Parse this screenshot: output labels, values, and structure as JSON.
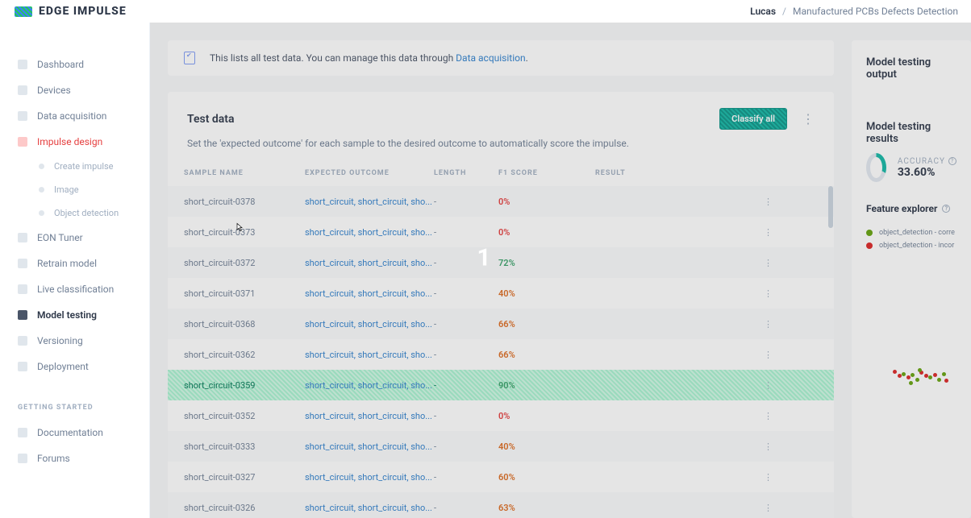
{
  "brand": "EDGE IMPULSE",
  "breadcrumb": {
    "user": "Lucas",
    "project": "Manufactured PCBs Defects Detection"
  },
  "sidebar": {
    "items": [
      {
        "label": "Dashboard"
      },
      {
        "label": "Devices"
      },
      {
        "label": "Data acquisition"
      },
      {
        "label": "Impulse design",
        "accent": true
      },
      {
        "label": "EON Tuner"
      },
      {
        "label": "Retrain model"
      },
      {
        "label": "Live classification"
      },
      {
        "label": "Model testing",
        "active": true
      },
      {
        "label": "Versioning"
      },
      {
        "label": "Deployment"
      }
    ],
    "subitems": [
      {
        "label": "Create impulse"
      },
      {
        "label": "Image"
      },
      {
        "label": "Object detection"
      }
    ],
    "section": "GETTING STARTED",
    "getting": [
      {
        "label": "Documentation"
      },
      {
        "label": "Forums"
      }
    ]
  },
  "banner": {
    "pre": "This lists all test data. You can manage this data through ",
    "link": "Data acquisition",
    "post": "."
  },
  "testdata": {
    "title": "Test data",
    "classify": "Classify all",
    "desc": "Set the 'expected outcome' for each sample to the desired outcome to automatically score the impulse.",
    "columns": {
      "c1": "SAMPLE NAME",
      "c2": "EXPECTED OUTCOME",
      "c3": "LENGTH",
      "c4": "F1 SCORE",
      "c5": "RESULT"
    },
    "rows": [
      {
        "name": "short_circuit-0378",
        "outcome": "short_circuit, short_circuit, sho...",
        "len": "-",
        "f1": "0%",
        "cls": "f1-red"
      },
      {
        "name": "short_circuit-0373",
        "outcome": "short_circuit, short_circuit, sho...",
        "len": "-",
        "f1": "0%",
        "cls": "f1-red"
      },
      {
        "name": "short_circuit-0372",
        "outcome": "short_circuit, short_circuit, sho...",
        "len": "-",
        "f1": "72%",
        "cls": "f1-green"
      },
      {
        "name": "short_circuit-0371",
        "outcome": "short_circuit, short_circuit, sho...",
        "len": "-",
        "f1": "40%",
        "cls": "f1-orange"
      },
      {
        "name": "short_circuit-0368",
        "outcome": "short_circuit, short_circuit, sho...",
        "len": "-",
        "f1": "66%",
        "cls": "f1-orange"
      },
      {
        "name": "short_circuit-0362",
        "outcome": "short_circuit, short_circuit, sho...",
        "len": "-",
        "f1": "66%",
        "cls": "f1-orange"
      },
      {
        "name": "short_circuit-0359",
        "outcome": "short_circuit, short_circuit, sho...",
        "len": "-",
        "f1": "90%",
        "cls": "f1-green",
        "selected": true
      },
      {
        "name": "short_circuit-0352",
        "outcome": "short_circuit, short_circuit, sho...",
        "len": "-",
        "f1": "0%",
        "cls": "f1-red"
      },
      {
        "name": "short_circuit-0333",
        "outcome": "short_circuit, short_circuit, sho...",
        "len": "-",
        "f1": "40%",
        "cls": "f1-orange"
      },
      {
        "name": "short_circuit-0327",
        "outcome": "short_circuit, short_circuit, sho...",
        "len": "-",
        "f1": "60%",
        "cls": "f1-orange"
      },
      {
        "name": "short_circuit-0326",
        "outcome": "short_circuit, short_circuit, sho...",
        "len": "-",
        "f1": "63%",
        "cls": "f1-orange"
      }
    ]
  },
  "output": {
    "title": "Model testing output",
    "results": "Model testing results",
    "accuracyLabel": "ACCURACY",
    "accuracy": "33.60%",
    "feat": "Feature explorer",
    "legend": [
      {
        "label": "object_detection - corre"
      },
      {
        "label": "object_detection - incor"
      }
    ]
  },
  "overlay": "1"
}
